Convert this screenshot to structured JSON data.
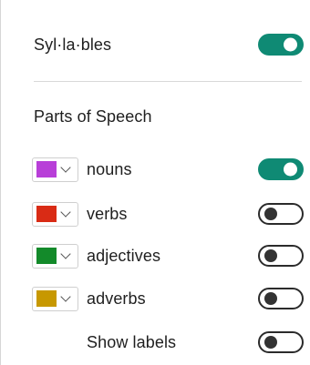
{
  "syllables": {
    "label": "Syl·la·bles",
    "enabled": true
  },
  "parts_of_speech": {
    "title": "Parts of Speech",
    "items": [
      {
        "label": "nouns",
        "color": "#b83fd8",
        "enabled": true
      },
      {
        "label": "verbs",
        "color": "#d92b15",
        "enabled": false
      },
      {
        "label": "adjectives",
        "color": "#138a2a",
        "enabled": false
      },
      {
        "label": "adverbs",
        "color": "#c79800",
        "enabled": false
      }
    ],
    "show_labels": {
      "label": "Show labels",
      "enabled": false
    }
  },
  "colors": {
    "toggle_on": "#0f8a74",
    "toggle_off_border": "#2b2b2b"
  },
  "icons": {
    "picker": "chevron-down-icon"
  }
}
